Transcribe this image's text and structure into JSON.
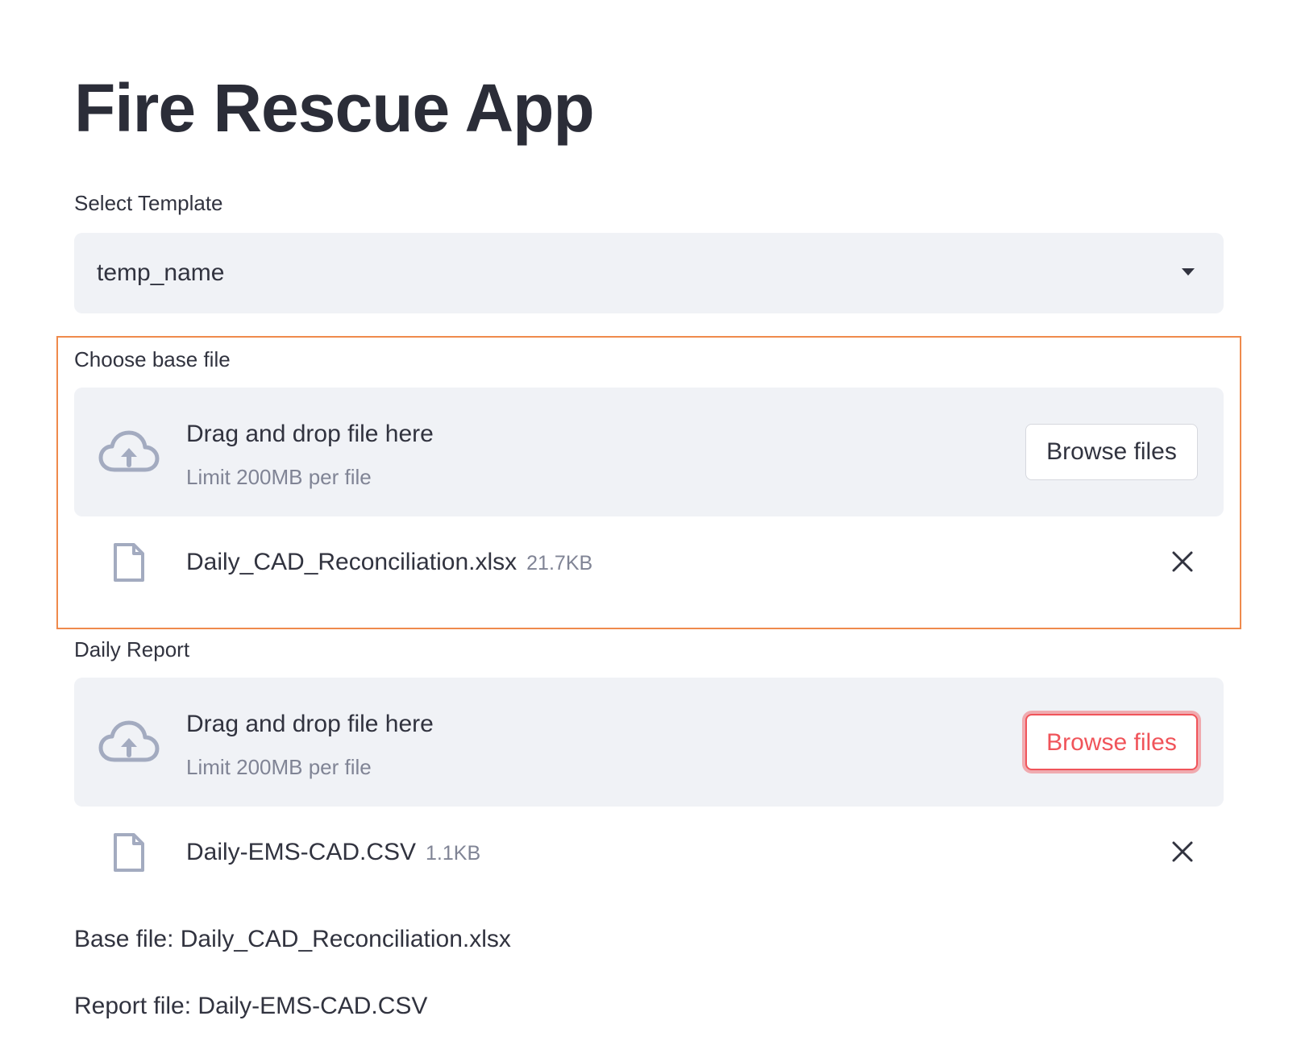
{
  "app": {
    "title": "Fire Rescue App"
  },
  "template_select": {
    "label": "Select Template",
    "value": "temp_name"
  },
  "base_uploader": {
    "label": "Choose base file",
    "dropzone_title": "Drag and drop file here",
    "dropzone_limit": "Limit 200MB per file",
    "browse_label": "Browse files",
    "file": {
      "name": "Daily_CAD_Reconciliation.xlsx",
      "size": "21.7KB"
    }
  },
  "report_uploader": {
    "label": "Daily Report",
    "dropzone_title": "Drag and drop file here",
    "dropzone_limit": "Limit 200MB per file",
    "browse_label": "Browse files",
    "file": {
      "name": "Daily-EMS-CAD.CSV",
      "size": "1.1KB"
    }
  },
  "results": {
    "base_line": "Base file: Daily_CAD_Reconciliation.xlsx",
    "report_line": "Report file: Daily-EMS-CAD.CSV"
  },
  "colors": {
    "highlight_border": "#ef8a4c",
    "focus_accent": "#f0545a",
    "widget_bg": "#f0f2f6",
    "icon_gray": "#a3abc0"
  },
  "icons": {
    "upload": "cloud-upload-icon",
    "file": "file-icon",
    "remove": "close-icon",
    "dropdown": "chevron-down-icon"
  }
}
